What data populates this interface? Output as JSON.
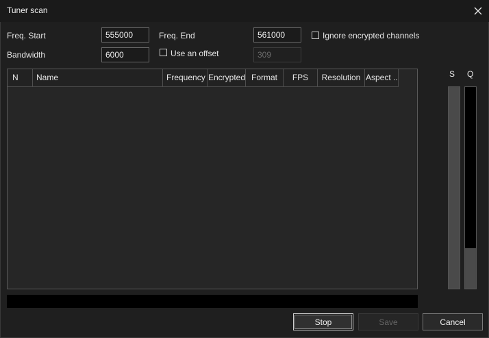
{
  "window": {
    "title": "Tuner scan"
  },
  "form": {
    "freq_start_label": "Freq. Start",
    "freq_start_value": "555000",
    "freq_end_label": "Freq. End",
    "freq_end_value": "561000",
    "bandwidth_label": "Bandwidth",
    "bandwidth_value": "6000",
    "ignore_encrypted_label": "Ignore encrypted channels",
    "use_offset_label": "Use an offset",
    "offset_value": "309"
  },
  "table": {
    "columns": [
      "N",
      "Name",
      "Frequency",
      "Encrypted",
      "Format",
      "FPS",
      "Resolution",
      "Aspect ..."
    ],
    "rows": []
  },
  "meters": {
    "signal_label": "S",
    "quality_label": "Q",
    "signal_level": 1.0,
    "quality_level": 0.2
  },
  "buttons": {
    "stop": "Stop",
    "save": "Save",
    "cancel": "Cancel"
  },
  "colors": {
    "background": "#1f1f1f",
    "progress_bar": "#000000",
    "meter_fill": "#4a4a4a"
  }
}
